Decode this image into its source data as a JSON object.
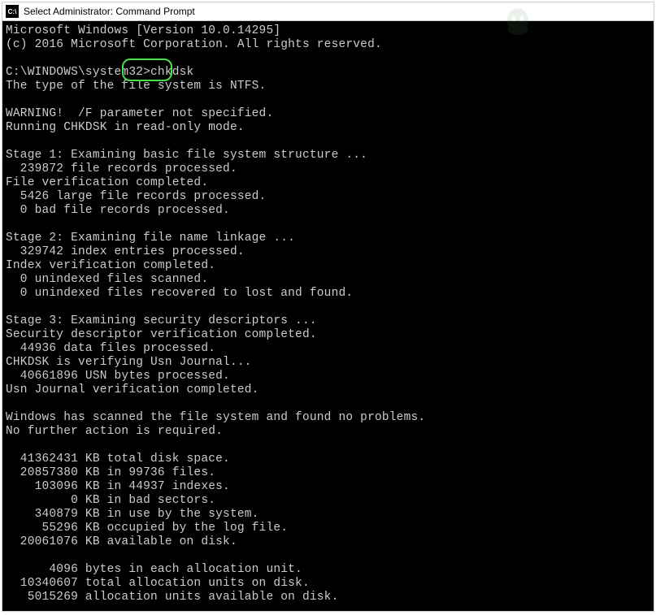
{
  "titlebar": {
    "icon_label": "C:\\",
    "title": "Select Administrator: Command Prompt"
  },
  "terminal": {
    "header_line1": "Microsoft Windows [Version 10.0.14295]",
    "header_line2": "(c) 2016 Microsoft Corporation. All rights reserved.",
    "prompt_path": "C:\\WINDOWS\\system32>",
    "command": "chkdsk",
    "fs_type": "The type of the file system is NTFS.",
    "warning": "WARNING!  /F parameter not specified.",
    "mode": "Running CHKDSK in read-only mode.",
    "stage1": {
      "title": "Stage 1: Examining basic file system structure ...",
      "records": "  239872 file records processed.",
      "completed": "File verification completed.",
      "large": "  5426 large file records processed.",
      "bad": "  0 bad file records processed."
    },
    "stage2": {
      "title": "Stage 2: Examining file name linkage ...",
      "index": "  329742 index entries processed.",
      "completed": "Index verification completed.",
      "unindexed_scanned": "  0 unindexed files scanned.",
      "unindexed_recovered": "  0 unindexed files recovered to lost and found."
    },
    "stage3": {
      "title": "Stage 3: Examining security descriptors ...",
      "completed": "Security descriptor verification completed.",
      "data_files": "  44936 data files processed.",
      "usn_verifying": "CHKDSK is verifying Usn Journal...",
      "usn_bytes": "  40661896 USN bytes processed.",
      "usn_completed": "Usn Journal verification completed."
    },
    "result": {
      "line1": "Windows has scanned the file system and found no problems.",
      "line2": "No further action is required."
    },
    "disk": {
      "total": "  41362431 KB total disk space.",
      "in_files": "  20857380 KB in 99736 files.",
      "in_indexes": "    103096 KB in 44937 indexes.",
      "bad_sectors": "         0 KB in bad sectors.",
      "system": "    340879 KB in use by the system.",
      "log": "     55296 KB occupied by the log file.",
      "available": "  20061076 KB available on disk."
    },
    "alloc": {
      "bytes": "      4096 bytes in each allocation unit.",
      "total": "  10340607 total allocation units on disk.",
      "available": "   5015269 allocation units available on disk."
    }
  }
}
